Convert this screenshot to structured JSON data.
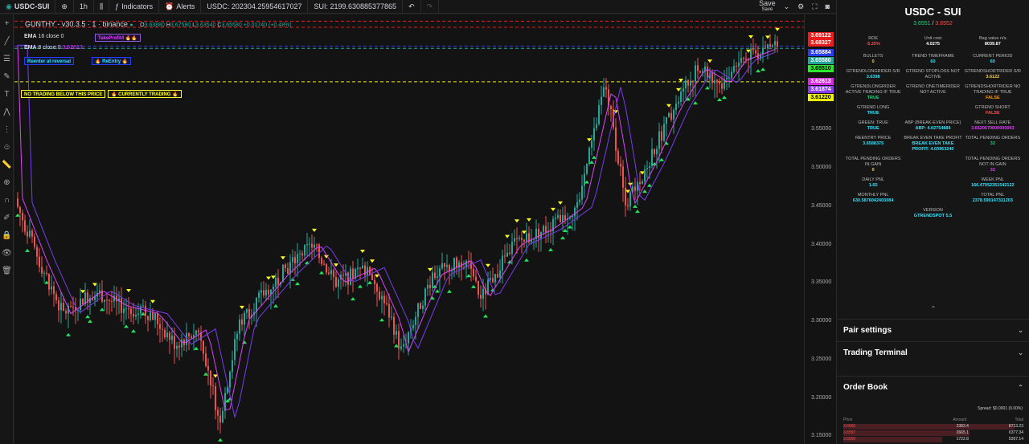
{
  "topbar": {
    "symbol": "USDC-SUI",
    "interval": "1h",
    "indicators": "Indicators",
    "alerts": "Alerts",
    "usdc": "USDC: 202304.25954617027",
    "sui": "SUI: 2199.630885377865",
    "save": "Save",
    "save_sub": "Save"
  },
  "legend": {
    "title": "GUNTHY - v30.3.5 · 1 · binance",
    "o_lbl": "O",
    "o": "3.63880",
    "h_lbl": "H",
    "h": "3.67590",
    "l_lbl": "L",
    "l": "3.63540",
    "c_lbl": "C",
    "c": "3.65580",
    "chg": "+0.01740 (+0.48%)"
  },
  "ema": [
    {
      "label": "EMA",
      "sub": "16 close 0"
    },
    {
      "label": "EMA",
      "sub": "8 close 0",
      "value": "3.62613"
    }
  ],
  "badges": {
    "takeprofit": "TakeProfit4",
    "reentry_rev": "Reenter at reversal",
    "reentry": "ReEntry",
    "no_trading": "NO TRADING BELOW THIS PRICE",
    "currently": "CURRENTLY TRADING"
  },
  "axis": {
    "ticks": [
      "3.55000",
      "3.50000",
      "3.45000",
      "3.40000",
      "3.35000",
      "3.30000",
      "3.25000",
      "3.20000",
      "3.15000"
    ],
    "tags": [
      {
        "v": "3.69122",
        "bg": "#e81d1d",
        "fg": "#ffffff"
      },
      {
        "v": "3.68327",
        "bg": "#e81d1d",
        "fg": "#ffffff"
      },
      {
        "v": "3.65884",
        "bg": "#2b3cf0",
        "fg": "#ffffff"
      },
      {
        "v": "3.65580",
        "bg": "#26a69a",
        "fg": "#ffffff"
      },
      {
        "v": "3.65510",
        "bg": "#2ee62e",
        "fg": "#000000"
      },
      {
        "v": "3.62613",
        "bg": "#d62ce0",
        "fg": "#ffffff"
      },
      {
        "v": "3.61874",
        "bg": "#8a3cf0",
        "fg": "#ffffff"
      },
      {
        "v": "3.61220",
        "bg": "#f2f20a",
        "fg": "#000000"
      }
    ]
  },
  "panel": {
    "title": "USDC - SUI",
    "bid": "3.6551",
    "ask": "3.6552",
    "roe_lbl": "ROE",
    "roe": "-5.25%",
    "unit_lbl": "Unit cost",
    "unit": "4.0275",
    "bag_lbl": "Bag value n/a",
    "bag": "8039.87",
    "cells": [
      {
        "l": "BULLETS",
        "v": "0",
        "c": "yellow"
      },
      {
        "l": "TREND TIMEFRAME",
        "v": "60",
        "c": "cyan"
      },
      {
        "l": "CURRENT PERIOD",
        "v": "60",
        "c": "cyan"
      },
      {
        "l": "GTRENDLONGRIDER S/R",
        "v": "3.6398",
        "c": "cyan"
      },
      {
        "l": "GTREND STOPLOSS NOT ACTIVE",
        "v": "",
        "c": "white"
      },
      {
        "l": "GTRENDSHORTRIDER S/R",
        "v": "3.6122",
        "c": "yellow"
      },
      {
        "l": "GTRENDLONGRIDER ACTIVE TRADING IF TRUE",
        "v": "TRUE",
        "c": "green"
      },
      {
        "l": "GTREND ONETIMERIDER NOT ACTIVE",
        "v": "",
        "c": "white"
      },
      {
        "l": "GTRENDSHORTRIDER NO TRADING IF TRUE",
        "v": "FALSE",
        "c": "orange"
      },
      {
        "l": "GTREND LONG",
        "v": "TRUE",
        "c": "cyan"
      },
      {
        "l": "",
        "v": "",
        "c": "white"
      },
      {
        "l": "GTREND SHORT",
        "v": "FALSE",
        "c": "red"
      },
      {
        "l": "GREEN: TRUE",
        "v": "TRUE",
        "c": "cyan"
      },
      {
        "l": "ABP (BREAK-EVEN PRICE)",
        "v": "ABP: 4.02754884",
        "c": "cyan"
      },
      {
        "l": "NEXT SELL RATE",
        "v": "3.6520670000000003",
        "c": "magenta"
      },
      {
        "l": "REENTRY PRICE",
        "v": "3.6588375",
        "c": "cyan"
      },
      {
        "l": "BREAK EVEN TAKE PROFIT",
        "v": "BREAK EVEN TAKE PROFIT: 4.03963240",
        "c": "cyan"
      },
      {
        "l": "TOTAL PENDING ORDERS",
        "v": "32",
        "c": "green"
      },
      {
        "l": "TOTAL PENDING ORDERS IN GAIN",
        "v": "0",
        "c": "yellow"
      },
      {
        "l": "",
        "v": "",
        "c": "white"
      },
      {
        "l": "TOTAL PENDING ORDERS NOT IN GAIN",
        "v": "32",
        "c": "magenta"
      },
      {
        "l": "DAILY PNL",
        "v": "1.65",
        "c": "cyan"
      },
      {
        "l": "",
        "v": "",
        "c": "white"
      },
      {
        "l": "WEEK PNL",
        "v": "166.47052351542122",
        "c": "cyan"
      },
      {
        "l": "MONTHLY PNL",
        "v": "630.5876042403084",
        "c": "cyan"
      },
      {
        "l": "",
        "v": "",
        "c": "white"
      },
      {
        "l": "TOTAL PNL",
        "v": "2378.590147311203",
        "c": "cyan"
      },
      {
        "l": "",
        "v": "",
        "c": "white"
      },
      {
        "l": "VERSION",
        "v": "GTRENDSPOT 5.5",
        "c": "cyan"
      },
      {
        "l": "",
        "v": "",
        "c": "white"
      }
    ],
    "pair_settings": "Pair settings",
    "trading_terminal": "Trading Terminal",
    "order_book": "Order Book",
    "spread": "Spread: $0.0001 (0.00%)",
    "ob_cols": [
      "Price",
      "Amount",
      "Total"
    ],
    "ob_rows": [
      {
        "p": "3.6600",
        "a": "2383.4",
        "t": "8713.23",
        "w": 0.95
      },
      {
        "p": "3.6597",
        "a": "2665.1",
        "t": "6377.34",
        "w": 0.7
      },
      {
        "p": "3.6590",
        "a": "1722.8",
        "t": "5267.14",
        "w": 0.55
      }
    ]
  }
}
